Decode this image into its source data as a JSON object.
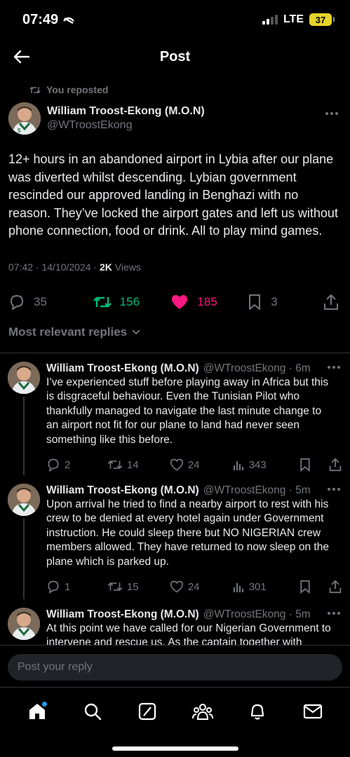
{
  "status_bar": {
    "time": "07:49",
    "network": "LTE",
    "battery": "37"
  },
  "header": {
    "title": "Post"
  },
  "main_post": {
    "repost_label": "You reposted",
    "author_name": "William Troost-Ekong (M.O.N)",
    "author_handle": "@WTroostEkong",
    "text": "12+ hours in an abandoned airport in Lybia after our plane was diverted whilst descending. Lybian government rescinded our approved landing in Benghazi with no reason. They’ve locked the airport gates and left us without phone connection, food or drink. All to play mind games.",
    "timestamp": "07:42 · 14/10/2024 · ",
    "views_count": "2K",
    "views_label": " Views",
    "replies": "35",
    "reposts": "156",
    "likes": "185",
    "bookmarks": "3"
  },
  "replies_filter": "Most relevant replies",
  "replies": [
    {
      "name": "William Troost-Ekong (M.O.N)",
      "handle": "@WTroostEkong · 6m",
      "text": "I’ve experienced stuff before playing away in Africa but this is disgraceful behaviour. Even the Tunisian Pilot who thankfully managed to navigate the last minute change to an airport not fit for our plane to land had never seen something like this before.",
      "replies": "2",
      "reposts": "14",
      "likes": "24",
      "views": "343"
    },
    {
      "name": "William Troost-Ekong (M.O.N)",
      "handle": "@WTroostEkong · 5m",
      "text": "Upon arrival he tried to find a nearby airport to rest with his crew to be denied at every hotel again under Government instruction. He could sleep there but NO NIGERIAN crew members allowed. They have returned to now sleep on the plane which is parked up.",
      "replies": "1",
      "reposts": "15",
      "likes": "24",
      "views": "301"
    },
    {
      "name": "William Troost-Ekong (M.O.N)",
      "handle": "@WTroostEkong · 5m",
      "text": "At this point we have called for our Nigerian Government to intervene and rescue us. As the captain together with",
      "replies": "",
      "reposts": "",
      "likes": "",
      "views": ""
    }
  ],
  "composer": {
    "placeholder": "Post your reply"
  },
  "colors": {
    "accent": "#1d9bf0",
    "repost": "#00ba7c",
    "like": "#f91880",
    "muted": "#71767b",
    "battery": "#e6d32a"
  },
  "bottom_nav": [
    "home-icon",
    "search-icon",
    "grok-icon",
    "communities-icon",
    "notifications-icon",
    "messages-icon"
  ]
}
